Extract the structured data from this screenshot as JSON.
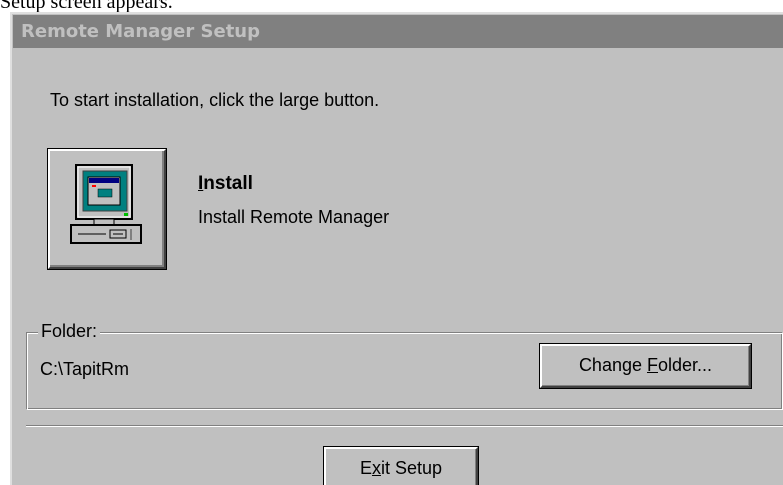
{
  "caption": "Setup screen appears.",
  "window": {
    "title": "Remote Manager Setup"
  },
  "instruction": "To start installation, click the large button.",
  "install": {
    "mnemonic": "I",
    "title_rest": "nstall",
    "description": "Install Remote Manager",
    "icon": "computer-icon"
  },
  "folder": {
    "legend": "Folder:",
    "path": "C:\\TapitRm",
    "change_button": {
      "prefix": "Change ",
      "mnemonic": "F",
      "suffix": "older..."
    }
  },
  "exit_button": {
    "prefix": "E",
    "mnemonic": "x",
    "suffix": "it Setup"
  },
  "colors": {
    "dialog_face": "#c0c0c0",
    "titlebar_inactive": "#808080",
    "monitor_screen": "#008080",
    "window_titlebar": "#000080"
  }
}
